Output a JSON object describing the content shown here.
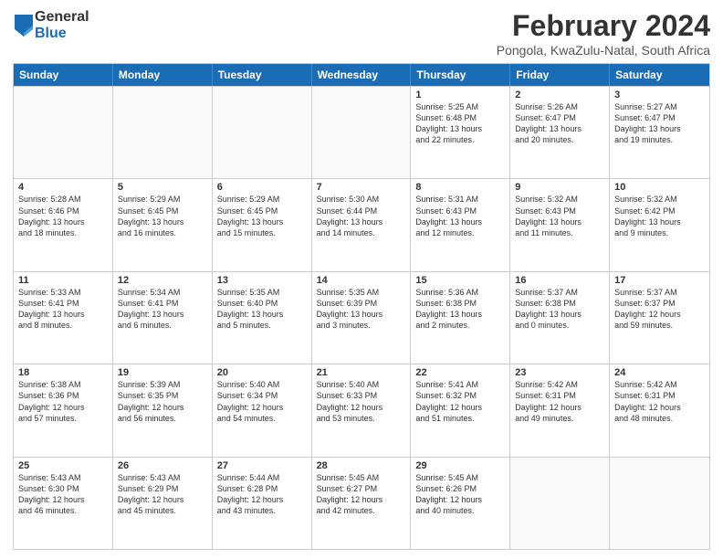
{
  "logo": {
    "general": "General",
    "blue": "Blue"
  },
  "header": {
    "title": "February 2024",
    "subtitle": "Pongola, KwaZulu-Natal, South Africa"
  },
  "weekdays": [
    "Sunday",
    "Monday",
    "Tuesday",
    "Wednesday",
    "Thursday",
    "Friday",
    "Saturday"
  ],
  "rows": [
    [
      {
        "day": "",
        "text": "",
        "empty": true
      },
      {
        "day": "",
        "text": "",
        "empty": true
      },
      {
        "day": "",
        "text": "",
        "empty": true
      },
      {
        "day": "",
        "text": "",
        "empty": true
      },
      {
        "day": "1",
        "text": "Sunrise: 5:25 AM\nSunset: 6:48 PM\nDaylight: 13 hours\nand 22 minutes."
      },
      {
        "day": "2",
        "text": "Sunrise: 5:26 AM\nSunset: 6:47 PM\nDaylight: 13 hours\nand 20 minutes."
      },
      {
        "day": "3",
        "text": "Sunrise: 5:27 AM\nSunset: 6:47 PM\nDaylight: 13 hours\nand 19 minutes."
      }
    ],
    [
      {
        "day": "4",
        "text": "Sunrise: 5:28 AM\nSunset: 6:46 PM\nDaylight: 13 hours\nand 18 minutes."
      },
      {
        "day": "5",
        "text": "Sunrise: 5:29 AM\nSunset: 6:45 PM\nDaylight: 13 hours\nand 16 minutes."
      },
      {
        "day": "6",
        "text": "Sunrise: 5:29 AM\nSunset: 6:45 PM\nDaylight: 13 hours\nand 15 minutes."
      },
      {
        "day": "7",
        "text": "Sunrise: 5:30 AM\nSunset: 6:44 PM\nDaylight: 13 hours\nand 14 minutes."
      },
      {
        "day": "8",
        "text": "Sunrise: 5:31 AM\nSunset: 6:43 PM\nDaylight: 13 hours\nand 12 minutes."
      },
      {
        "day": "9",
        "text": "Sunrise: 5:32 AM\nSunset: 6:43 PM\nDaylight: 13 hours\nand 11 minutes."
      },
      {
        "day": "10",
        "text": "Sunrise: 5:32 AM\nSunset: 6:42 PM\nDaylight: 13 hours\nand 9 minutes."
      }
    ],
    [
      {
        "day": "11",
        "text": "Sunrise: 5:33 AM\nSunset: 6:41 PM\nDaylight: 13 hours\nand 8 minutes."
      },
      {
        "day": "12",
        "text": "Sunrise: 5:34 AM\nSunset: 6:41 PM\nDaylight: 13 hours\nand 6 minutes."
      },
      {
        "day": "13",
        "text": "Sunrise: 5:35 AM\nSunset: 6:40 PM\nDaylight: 13 hours\nand 5 minutes."
      },
      {
        "day": "14",
        "text": "Sunrise: 5:35 AM\nSunset: 6:39 PM\nDaylight: 13 hours\nand 3 minutes."
      },
      {
        "day": "15",
        "text": "Sunrise: 5:36 AM\nSunset: 6:38 PM\nDaylight: 13 hours\nand 2 minutes."
      },
      {
        "day": "16",
        "text": "Sunrise: 5:37 AM\nSunset: 6:38 PM\nDaylight: 13 hours\nand 0 minutes."
      },
      {
        "day": "17",
        "text": "Sunrise: 5:37 AM\nSunset: 6:37 PM\nDaylight: 12 hours\nand 59 minutes."
      }
    ],
    [
      {
        "day": "18",
        "text": "Sunrise: 5:38 AM\nSunset: 6:36 PM\nDaylight: 12 hours\nand 57 minutes."
      },
      {
        "day": "19",
        "text": "Sunrise: 5:39 AM\nSunset: 6:35 PM\nDaylight: 12 hours\nand 56 minutes."
      },
      {
        "day": "20",
        "text": "Sunrise: 5:40 AM\nSunset: 6:34 PM\nDaylight: 12 hours\nand 54 minutes."
      },
      {
        "day": "21",
        "text": "Sunrise: 5:40 AM\nSunset: 6:33 PM\nDaylight: 12 hours\nand 53 minutes."
      },
      {
        "day": "22",
        "text": "Sunrise: 5:41 AM\nSunset: 6:32 PM\nDaylight: 12 hours\nand 51 minutes."
      },
      {
        "day": "23",
        "text": "Sunrise: 5:42 AM\nSunset: 6:31 PM\nDaylight: 12 hours\nand 49 minutes."
      },
      {
        "day": "24",
        "text": "Sunrise: 5:42 AM\nSunset: 6:31 PM\nDaylight: 12 hours\nand 48 minutes."
      }
    ],
    [
      {
        "day": "25",
        "text": "Sunrise: 5:43 AM\nSunset: 6:30 PM\nDaylight: 12 hours\nand 46 minutes."
      },
      {
        "day": "26",
        "text": "Sunrise: 5:43 AM\nSunset: 6:29 PM\nDaylight: 12 hours\nand 45 minutes."
      },
      {
        "day": "27",
        "text": "Sunrise: 5:44 AM\nSunset: 6:28 PM\nDaylight: 12 hours\nand 43 minutes."
      },
      {
        "day": "28",
        "text": "Sunrise: 5:45 AM\nSunset: 6:27 PM\nDaylight: 12 hours\nand 42 minutes."
      },
      {
        "day": "29",
        "text": "Sunrise: 5:45 AM\nSunset: 6:26 PM\nDaylight: 12 hours\nand 40 minutes."
      },
      {
        "day": "",
        "text": "",
        "empty": true
      },
      {
        "day": "",
        "text": "",
        "empty": true
      }
    ]
  ]
}
